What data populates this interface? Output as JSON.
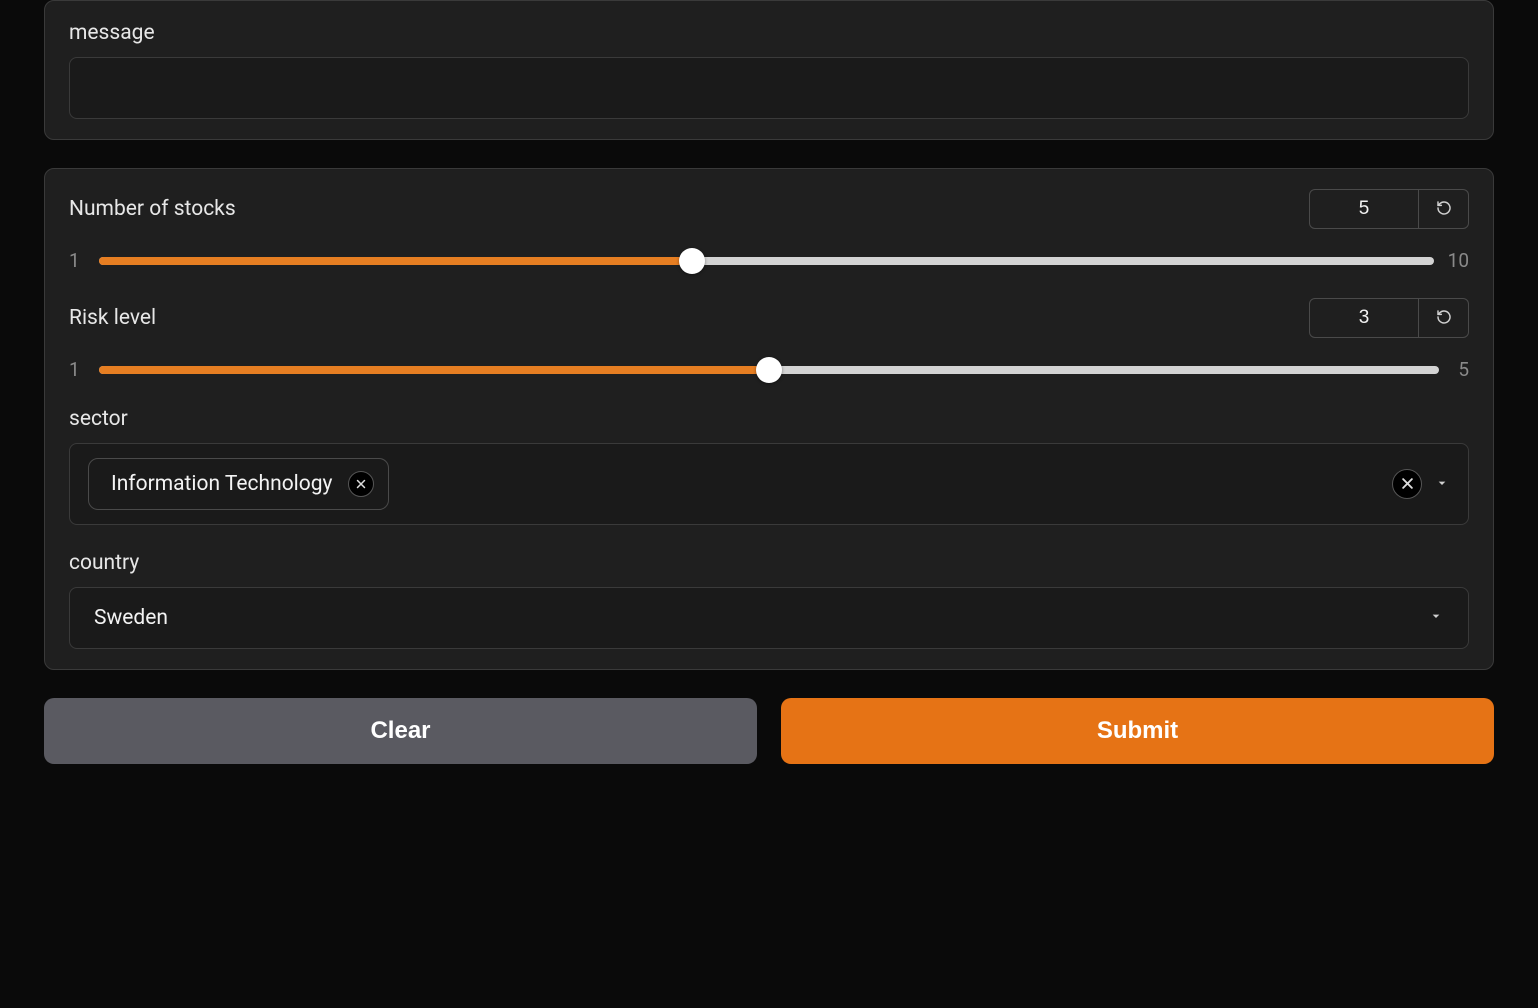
{
  "message": {
    "label": "message",
    "value": ""
  },
  "sliders": {
    "stocks": {
      "label": "Number of stocks",
      "min": "1",
      "max": "10",
      "value": "5",
      "percent": 44.4
    },
    "risk": {
      "label": "Risk level",
      "min": "1",
      "max": "5",
      "value": "3",
      "percent": 50
    }
  },
  "sector": {
    "label": "sector",
    "selected": [
      {
        "label": "Information Technology"
      }
    ]
  },
  "country": {
    "label": "country",
    "value": "Sweden"
  },
  "buttons": {
    "clear": "Clear",
    "submit": "Submit"
  }
}
